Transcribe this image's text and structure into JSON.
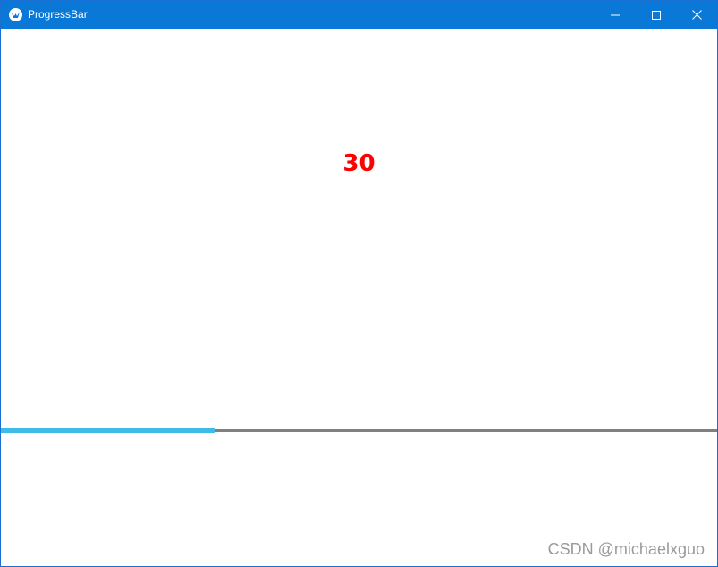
{
  "window": {
    "title": "ProgressBar",
    "title_bar_color": "#0a78d7",
    "icon": "kivy-logo-icon"
  },
  "window_controls": {
    "minimize_icon": "minimize-icon",
    "maximize_icon": "maximize-icon",
    "close_icon": "close-icon"
  },
  "main": {
    "value_text": "30",
    "value_color": "#ff0000",
    "progress": {
      "value": 30,
      "max": 100,
      "fill_color": "#3fbbe8",
      "track_color": "#808080"
    }
  },
  "watermark": "CSDN @michaelxguo"
}
